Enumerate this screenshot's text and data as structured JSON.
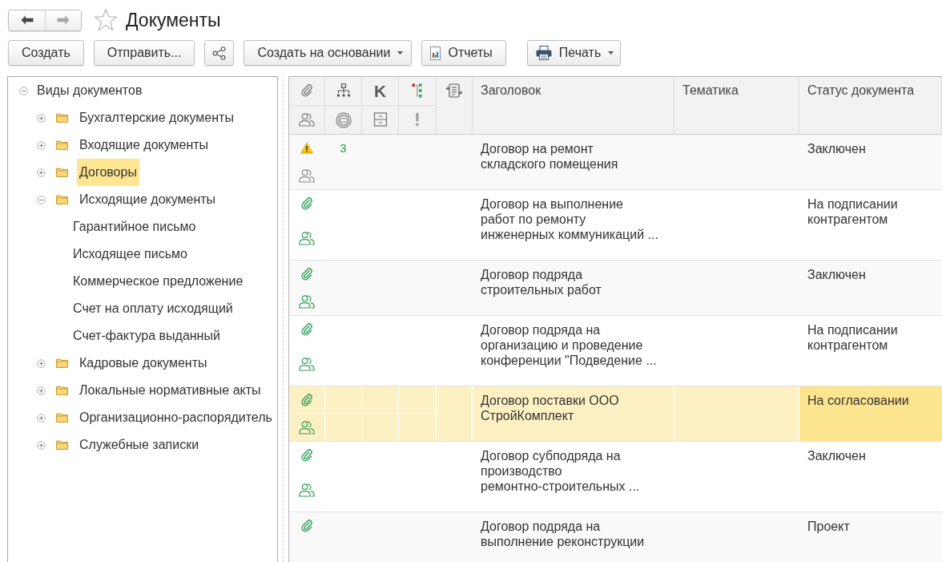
{
  "navigation": [
    {
      "kind": "back",
      "disabled": false
    },
    {
      "kind": "forward",
      "disabled": true
    }
  ],
  "favorite": false,
  "title": "Документы",
  "toolbar": [
    {
      "kind": "plain",
      "label": "Создать"
    },
    {
      "kind": "plain",
      "label": "Отправить..."
    },
    {
      "kind": "share"
    },
    {
      "kind": "menu",
      "label": "Создать на основании"
    },
    {
      "kind": "report",
      "label": "Отчеты"
    },
    {
      "kind": "print",
      "label": "Печать"
    }
  ],
  "tree": {
    "kind": "group",
    "label": "Виды документов",
    "expanded": true,
    "selected": false,
    "children": [
      {
        "kind": "folder",
        "label": "Бухгалтерские документы",
        "expanded": false,
        "selected": false
      },
      {
        "kind": "folder",
        "label": "Входящие документы",
        "expanded": false,
        "selected": false
      },
      {
        "kind": "folder",
        "label": "Договоры",
        "expanded": false,
        "selected": true
      },
      {
        "kind": "folder",
        "label": "Исходящие документы",
        "expanded": true,
        "selected": false,
        "children": [
          {
            "kind": "item",
            "label": "Гарантийное письмо",
            "selected": false
          },
          {
            "kind": "item",
            "label": "Исходящее письмо",
            "selected": false
          },
          {
            "kind": "item",
            "label": "Коммерческое предложение",
            "selected": false
          },
          {
            "kind": "item",
            "label": "Счет на оплату исходящий",
            "selected": false
          },
          {
            "kind": "item",
            "label": "Счет-фактура выданный",
            "selected": false
          }
        ]
      },
      {
        "kind": "folder",
        "label": "Кадровые документы",
        "expanded": false,
        "selected": false
      },
      {
        "kind": "folder",
        "label": "Локальные нормативные акты",
        "expanded": false,
        "selected": false
      },
      {
        "kind": "folder",
        "label": "Организационно-распорядитель",
        "expanded": false,
        "selected": false
      },
      {
        "kind": "folder",
        "label": "Служебные записки",
        "expanded": false,
        "selected": false
      }
    ]
  },
  "table": {
    "marker_column_label": "K",
    "columns": [
      {
        "label": "Заголовок"
      },
      {
        "label": "Тематика"
      },
      {
        "label": "Статус документа"
      }
    ],
    "rows": [
      {
        "warning": true,
        "attachment": false,
        "participants": true,
        "participants_active": false,
        "count": "3",
        "title": "Договор на ремонт\nскладского помещения",
        "status": "Заключен",
        "selected": false
      },
      {
        "warning": false,
        "attachment": true,
        "participants": true,
        "participants_active": true,
        "title": "Договор на выполнение\nработ по ремонту\nинженерных коммуникаций ...",
        "status": "На подписании контрагентом",
        "selected": false
      },
      {
        "warning": false,
        "attachment": true,
        "participants": true,
        "participants_active": true,
        "title": "Договор подряда\nстроительных работ",
        "status": "Заключен",
        "selected": false
      },
      {
        "warning": false,
        "attachment": true,
        "participants": true,
        "participants_active": true,
        "title": "Договор подряда на\nорганизацию и проведение\nконференции \"Подведение ...",
        "status": "На подписании контрагентом",
        "selected": false
      },
      {
        "warning": false,
        "attachment": true,
        "participants": true,
        "participants_active": true,
        "title": "Договор поставки ООО\nСтройКомплект",
        "status": "На согласовании",
        "selected": true
      },
      {
        "warning": false,
        "attachment": true,
        "participants": true,
        "participants_active": true,
        "title": "Договор субподряда на\nпроизводство\nремонтно-строительных ...",
        "status": "Заключен",
        "selected": false
      },
      {
        "warning": false,
        "attachment": true,
        "participants": false,
        "title": "Договор подряда на\nвыполнение реконструкции",
        "status": "Проект",
        "selected": false
      }
    ]
  }
}
